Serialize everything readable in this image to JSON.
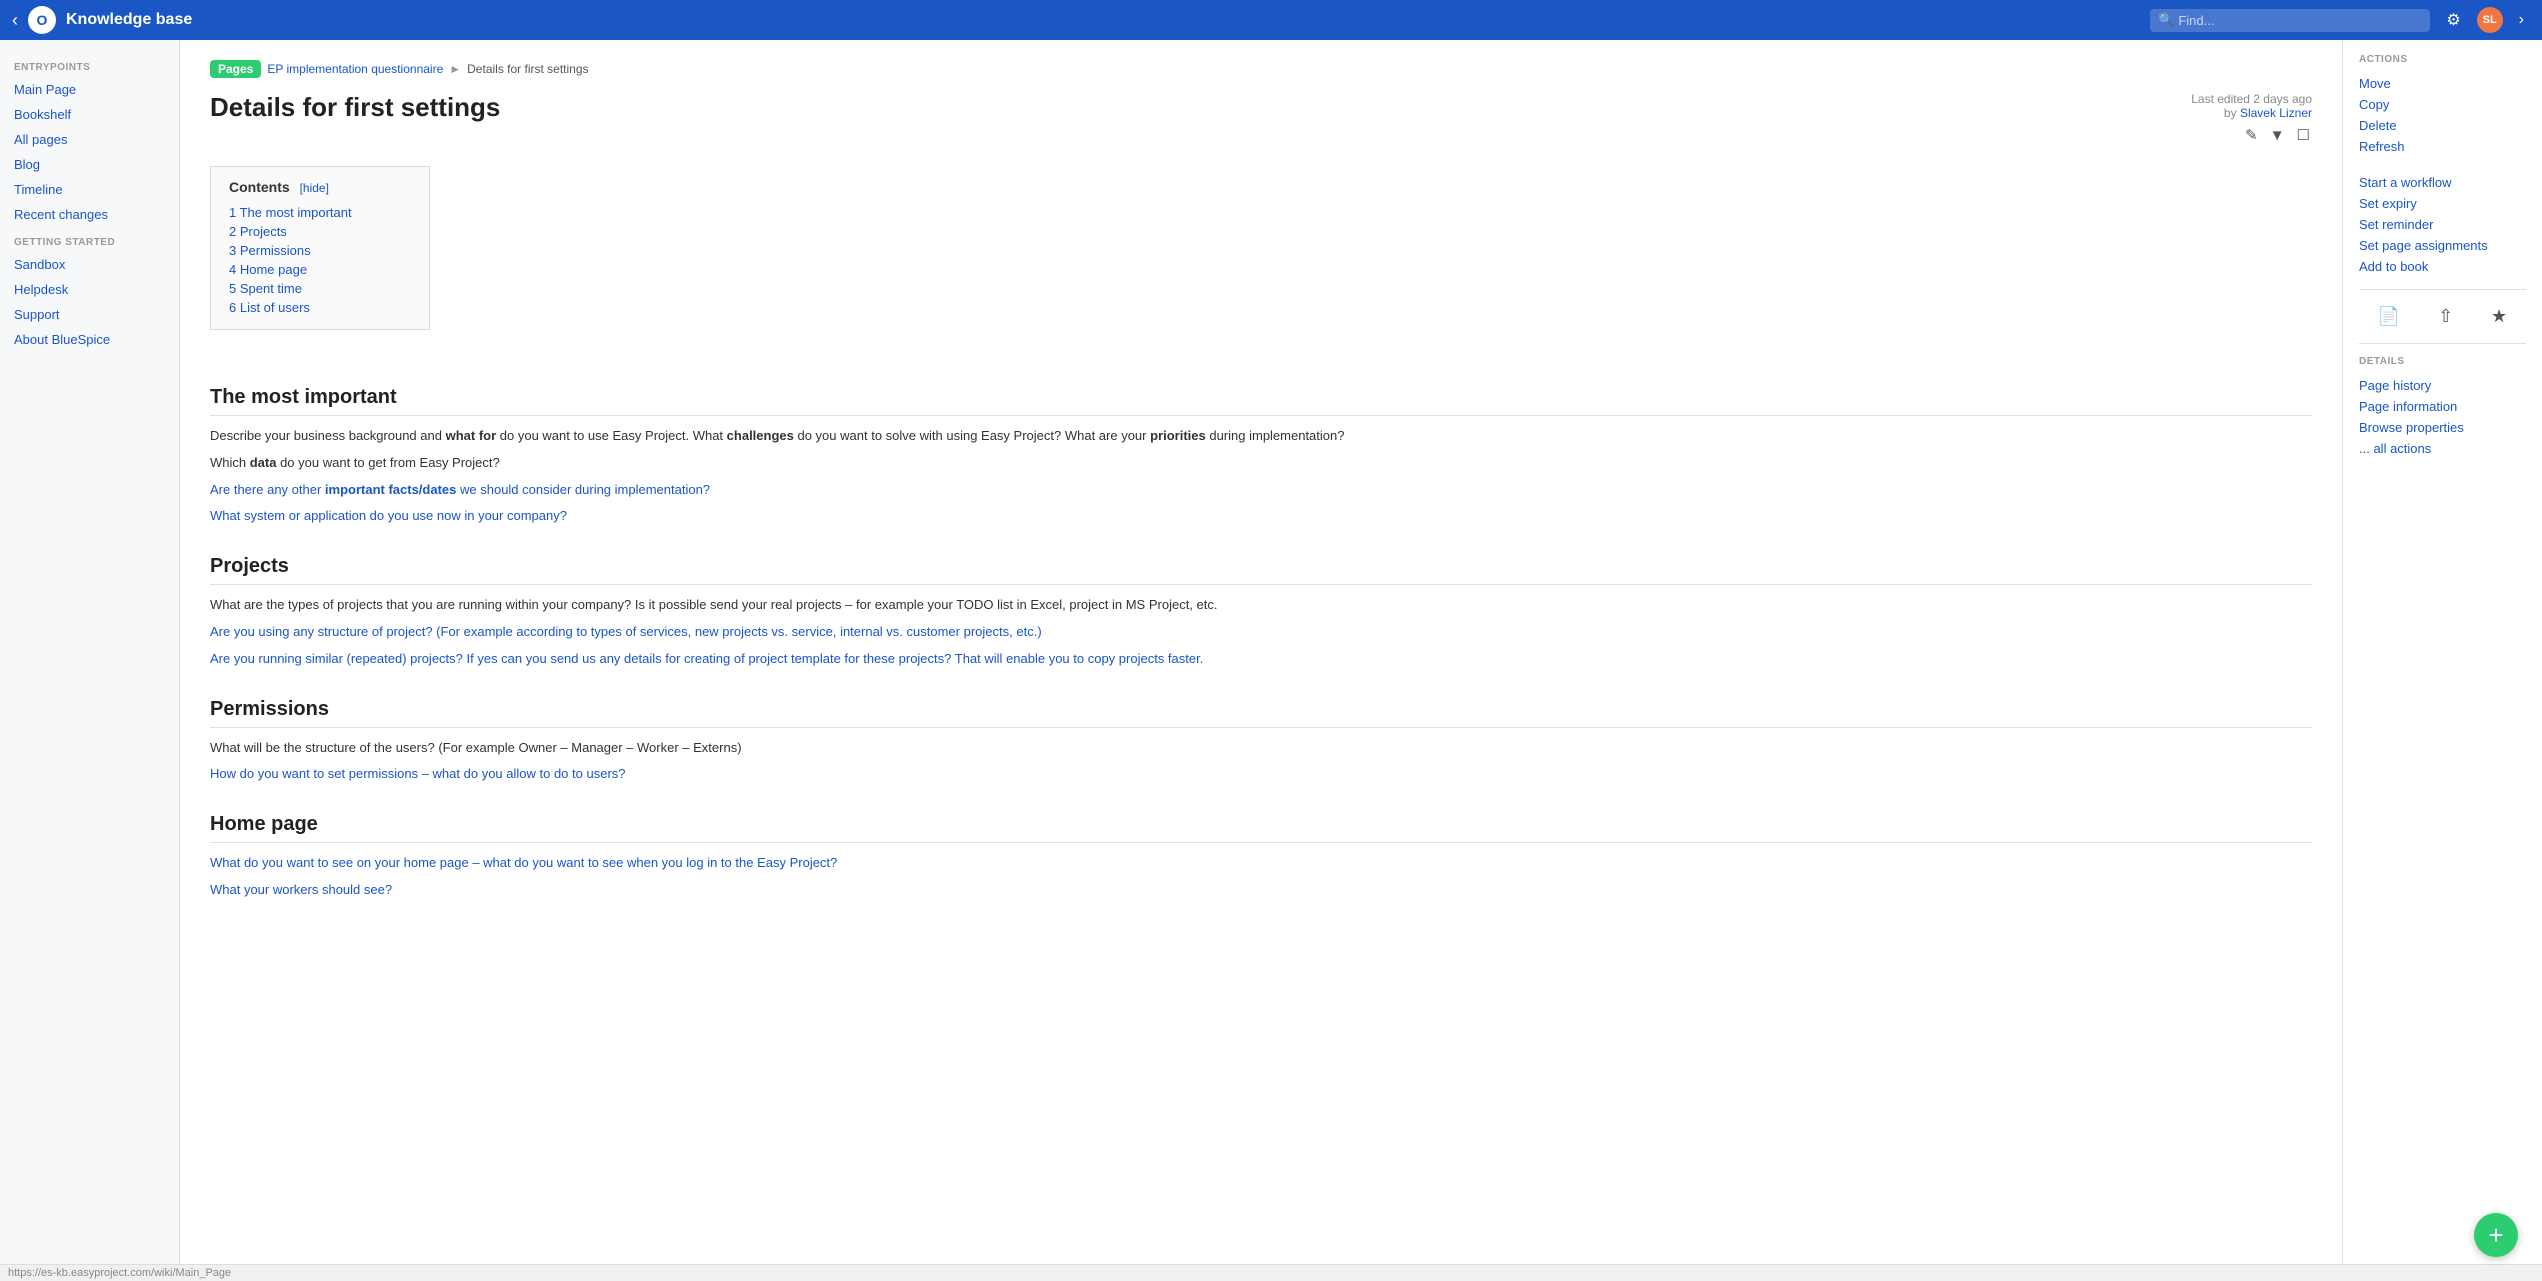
{
  "topnav": {
    "logo_letter": "O",
    "title": "Knowledge base",
    "search_placeholder": "Find...",
    "settings_icon": "⚙",
    "chevron_icon": "›",
    "avatar_text": "SL"
  },
  "sidebar": {
    "entrypoints_label": "ENTRYPOINTS",
    "entrypoints_items": [
      {
        "label": "Main Page"
      },
      {
        "label": "Bookshelf"
      },
      {
        "label": "All pages"
      },
      {
        "label": "Blog"
      },
      {
        "label": "Timeline"
      },
      {
        "label": "Recent changes"
      }
    ],
    "getting_started_label": "GETTING STARTED",
    "getting_started_items": [
      {
        "label": "Sandbox"
      },
      {
        "label": "Helpdesk"
      },
      {
        "label": "Support"
      },
      {
        "label": "About BlueSpice"
      }
    ]
  },
  "breadcrumb": {
    "pages_label": "Pages",
    "parent_page": "EP implementation questionnaire",
    "separator": "▶",
    "current_page": "Details for first settings"
  },
  "page_meta": {
    "last_edited_prefix": "Last edited",
    "time_ago": "2 days ago",
    "by_prefix": "by",
    "author": "Slavek Lizner"
  },
  "page": {
    "title": "Details for first settings",
    "contents_title": "Contents",
    "hide_label": "[hide]",
    "toc": [
      {
        "num": "1",
        "label": "The most important"
      },
      {
        "num": "2",
        "label": "Projects"
      },
      {
        "num": "3",
        "label": "Permissions"
      },
      {
        "num": "4",
        "label": "Home page"
      },
      {
        "num": "5",
        "label": "Spent time"
      },
      {
        "num": "6",
        "label": "List of users"
      }
    ],
    "sections": [
      {
        "id": "most-important",
        "heading": "The most important",
        "paragraphs": [
          "Describe your business background and what for do you want to use Easy Project. What challenges do you want to solve with using Easy Project? What are your priorities during implementation?",
          "Which data do you want to get from Easy Project?",
          "Are there any other important facts/dates we should consider during implementation?",
          "What system or application do you use now in your company?"
        ]
      },
      {
        "id": "projects",
        "heading": "Projects",
        "paragraphs": [
          "What are the types of projects that you are running within your company? Is it possible send your real projects – for example your TODO list in Excel, project in MS Project, etc.",
          "Are you using any structure of project? (For example according to types of services, new projects vs. service, internal vs. customer projects, etc.)",
          "Are you running similar (repeated) projects? If yes can you send us any details for creating of project template for these projects? That will enable you to copy projects faster."
        ]
      },
      {
        "id": "permissions",
        "heading": "Permissions",
        "paragraphs": [
          "What will be the structure of the users? (For example Owner – Manager – Worker – Externs)",
          "How do you want to set permissions – what do you allow to do to users?"
        ]
      },
      {
        "id": "home-page",
        "heading": "Home page",
        "paragraphs": [
          "What do you want to see on your home page – what do you want to see when you log in to the Easy Project?",
          "What your workers should see?"
        ]
      }
    ]
  },
  "actions": {
    "section_label": "ACTIONS",
    "items": [
      {
        "label": "Move"
      },
      {
        "label": "Copy"
      },
      {
        "label": "Delete"
      },
      {
        "label": "Refresh"
      },
      {
        "label": "Start a workflow"
      },
      {
        "label": "Set expiry"
      },
      {
        "label": "Set reminder"
      },
      {
        "label": "Set page assignments"
      },
      {
        "label": "Add to book"
      }
    ]
  },
  "details": {
    "section_label": "DETAILS",
    "items": [
      {
        "label": "Page history"
      },
      {
        "label": "Page information"
      },
      {
        "label": "Browse properties"
      },
      {
        "label": "... all actions"
      }
    ]
  },
  "status_bar": {
    "url": "https://es-kb.easyproject.com/wiki/Main_Page"
  },
  "fab": {
    "icon": "+"
  }
}
